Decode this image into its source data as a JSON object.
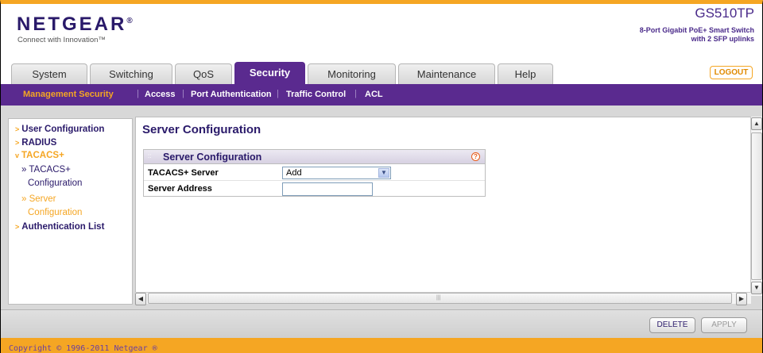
{
  "header": {
    "brand": "NETGEAR",
    "brand_mark": "®",
    "tagline": "Connect with Innovation™",
    "model": "GS510TP",
    "model_desc_line1": "8-Port Gigabit PoE+ Smart Switch",
    "model_desc_line2": "with 2 SFP uplinks"
  },
  "tabs": [
    {
      "label": "System"
    },
    {
      "label": "Switching"
    },
    {
      "label": "QoS"
    },
    {
      "label": "Security",
      "active": true
    },
    {
      "label": "Monitoring"
    },
    {
      "label": "Maintenance"
    },
    {
      "label": "Help"
    }
  ],
  "logout_label": "LOGOUT",
  "subnav": [
    {
      "label": "Management Security",
      "active": true
    },
    {
      "label": "Access"
    },
    {
      "label": "Port Authentication"
    },
    {
      "label": "Traffic Control"
    },
    {
      "label": "ACL"
    }
  ],
  "subnav_separator": "|",
  "leftnav": {
    "items": [
      {
        "label": "User Configuration"
      },
      {
        "label": "RADIUS"
      },
      {
        "label": "TACACS+",
        "open": true
      },
      {
        "label": "Authentication List"
      }
    ],
    "sub_items": [
      {
        "line1": "» TACACS+",
        "line2": "Configuration"
      },
      {
        "line1": "» Server",
        "line2": "Configuration",
        "current": true
      }
    ]
  },
  "main": {
    "page_title": "Server Configuration",
    "panel_title": "Server Configuration",
    "help_glyph": "?",
    "fields": [
      {
        "label": "TACACS+ Server",
        "value": "Add"
      },
      {
        "label": "Server Address",
        "value": ""
      }
    ]
  },
  "buttons": {
    "delete": "DELETE",
    "apply": "APPLY"
  },
  "footer": {
    "copyright": "Copyright © 1996-2011 Netgear ®"
  },
  "colors": {
    "brand_purple": "#5a2a8f",
    "accent_orange": "#f5a623",
    "nav_text": "#2a1a6a"
  }
}
